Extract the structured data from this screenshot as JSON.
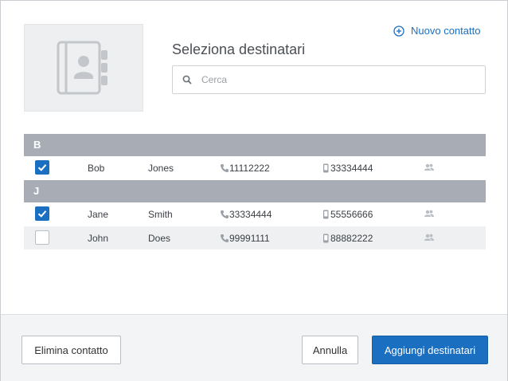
{
  "header": {
    "title": "Seleziona destinatari",
    "new_contact_label": "Nuovo contatto"
  },
  "search": {
    "placeholder": "Cerca",
    "value": ""
  },
  "groups": [
    {
      "letter": "B",
      "contacts": [
        {
          "checked": true,
          "first": "Bob",
          "last": "Jones",
          "phone": "11112222",
          "mobile": "33334444"
        }
      ]
    },
    {
      "letter": "J",
      "contacts": [
        {
          "checked": true,
          "first": "Jane",
          "last": "Smith",
          "phone": "33334444",
          "mobile": "55556666"
        },
        {
          "checked": false,
          "first": "John",
          "last": "Does",
          "phone": "99991111",
          "mobile": "88882222"
        }
      ]
    }
  ],
  "footer": {
    "delete_label": "Elimina contatto",
    "cancel_label": "Annulla",
    "add_label": "Aggiungi destinatari"
  },
  "colors": {
    "accent": "#1a6fc1",
    "group_header": "#a8adb5",
    "row_alt": "#eef0f2"
  }
}
